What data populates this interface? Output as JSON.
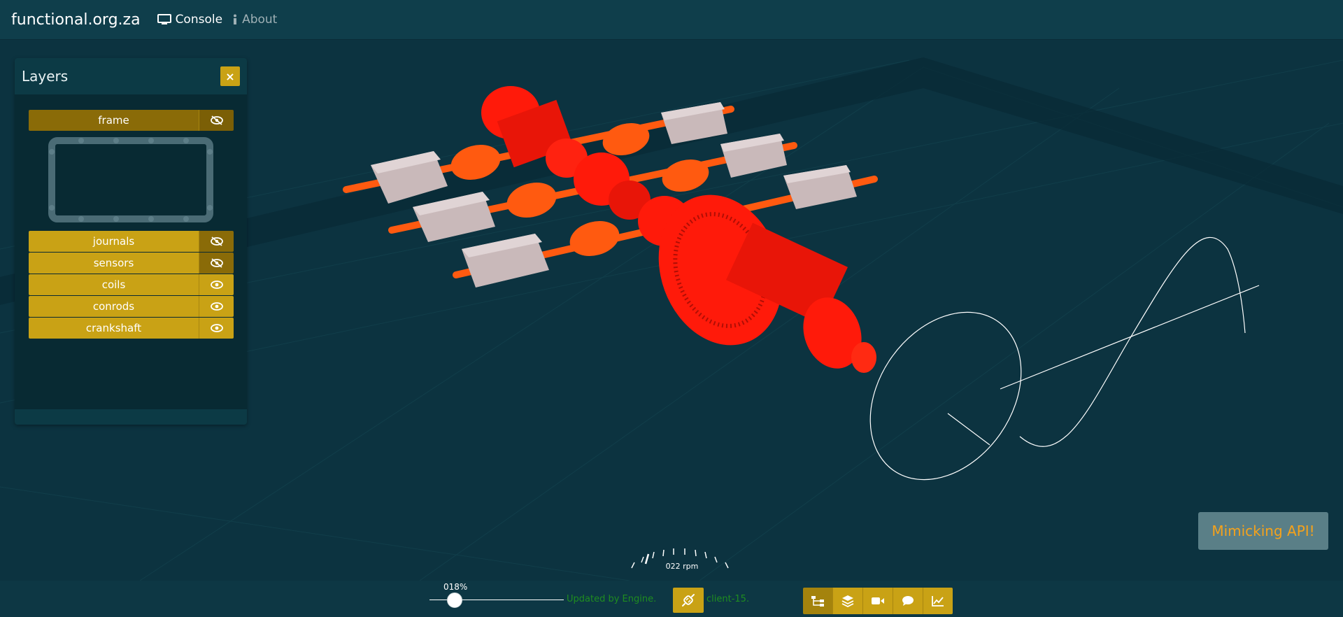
{
  "navbar": {
    "brand": "functional.org.za",
    "links": [
      {
        "label": "Console",
        "icon": "monitor-icon",
        "active": true
      },
      {
        "label": "About",
        "icon": "info-icon",
        "active": false
      }
    ]
  },
  "layers_panel": {
    "title": "Layers",
    "close_label": "×",
    "layers": [
      {
        "label": "frame",
        "visible": false
      },
      {
        "label": "journals",
        "visible": false
      },
      {
        "label": "sensors",
        "visible": false
      },
      {
        "label": "coils",
        "visible": true
      },
      {
        "label": "conrods",
        "visible": true
      },
      {
        "label": "crankshaft",
        "visible": true
      }
    ]
  },
  "toast": {
    "message": "Mimicking API!"
  },
  "gauge": {
    "rpm_label": "022 rpm"
  },
  "status": {
    "progress_label": "018%",
    "progress_value": 18,
    "update_text": "Updated by Engine.",
    "client_text": "client-15."
  },
  "toolbar": {
    "buttons": [
      "network-icon",
      "layers-icon",
      "camera-icon",
      "chat-icon",
      "chart-icon"
    ]
  },
  "colors": {
    "background": "#0c3340",
    "accent": "#c9a215",
    "status_green": "#1f8d20",
    "toast_text": "#f5a21b",
    "part_red": "#ff1a0a",
    "rod_orange": "#ff5a10"
  }
}
